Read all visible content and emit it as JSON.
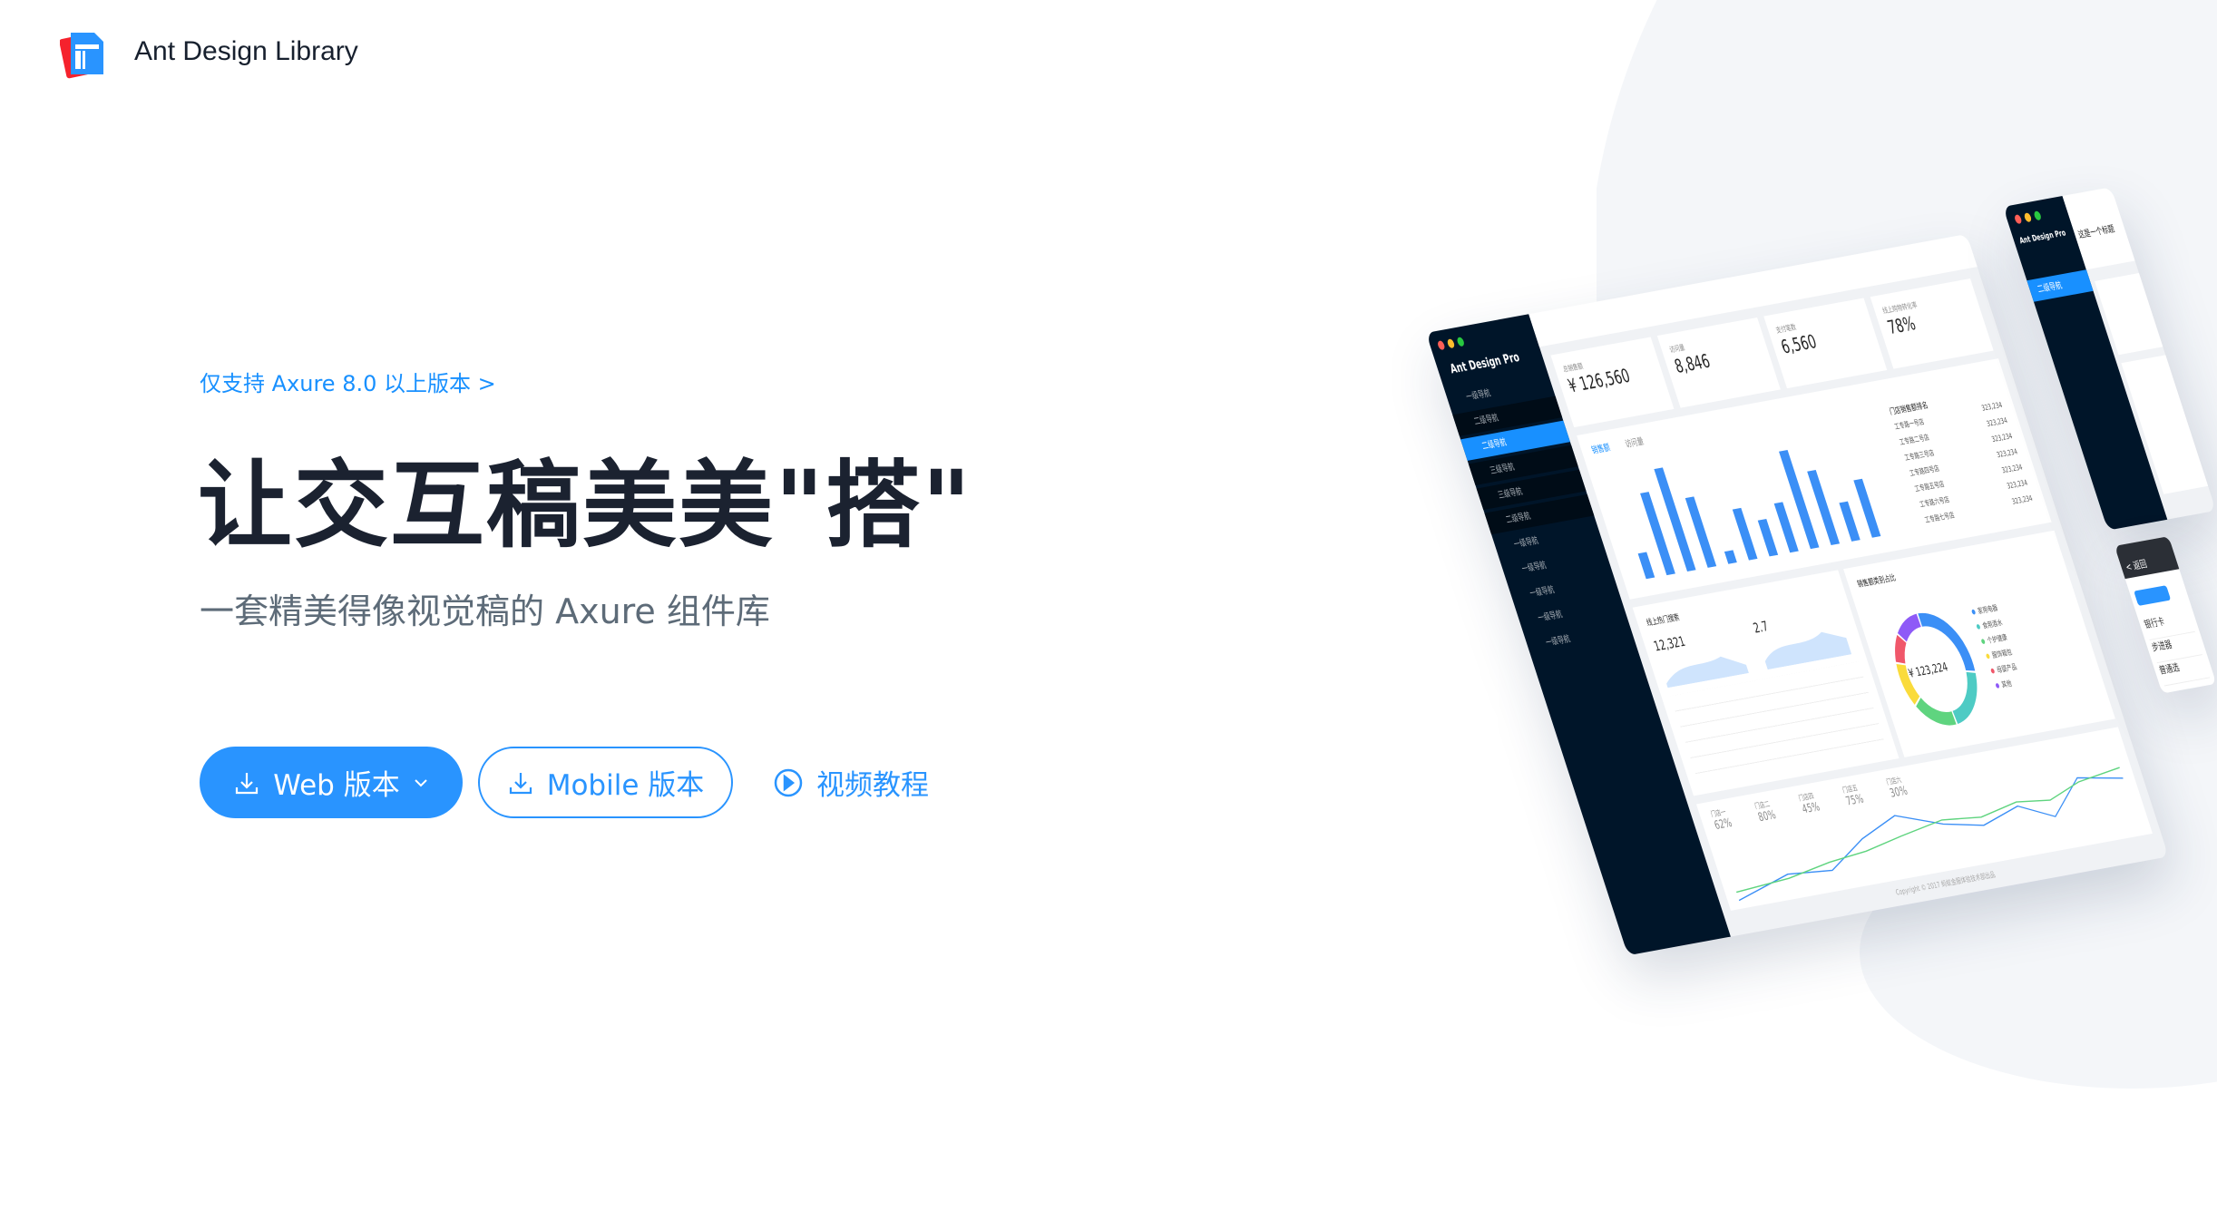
{
  "brand": {
    "name": "Ant Design Library",
    "colors": {
      "red": "#f5222d",
      "blue": "#2994ff"
    }
  },
  "hero": {
    "support_link": "仅支持 Axure 8.0 以上版本 >",
    "title": "让交互稿美美\"搭\"",
    "subtitle": "一套精美得像视觉稿的 Axure 组件库"
  },
  "actions": {
    "web": {
      "label": "Web 版本",
      "icon": "download-icon",
      "dropdown_icon": "chevron-down-icon"
    },
    "mobile": {
      "label": "Mobile 版本",
      "icon": "download-icon"
    },
    "video": {
      "label": "视频教程",
      "icon": "play-circle-icon"
    }
  },
  "colors": {
    "primary": "#1890ff",
    "button": "#2994ff",
    "title": "#1b2230",
    "subtitle": "#5d6b78",
    "sidebar": "#001529"
  },
  "mockup": {
    "app_title": "Ant Design Pro",
    "nav": [
      "一级导航",
      "二级导航",
      "二级导航",
      "三级导航",
      "三级导航",
      "二级导航",
      "一级导航",
      "一级导航",
      "一级导航",
      "一级导航",
      "一级导航"
    ],
    "stats": [
      {
        "label": "总销售额",
        "value": "¥ 126,560"
      },
      {
        "label": "访问量",
        "value": "8,846"
      },
      {
        "label": "支付笔数",
        "value": "6,560"
      },
      {
        "label": "线上购物转化率",
        "value": "78%"
      }
    ],
    "tabs": [
      "销售额",
      "访问量"
    ],
    "bars": [
      250,
      800,
      1000,
      680,
      120,
      500,
      350,
      480,
      950,
      720,
      380,
      560
    ],
    "ranking_title": "门店销售额排名",
    "ranking": [
      "工专路一号店",
      "工专路二号店",
      "工专路三号店",
      "工专路四号店",
      "工专路五号店",
      "工专路六号店",
      "工专路七号店"
    ],
    "ranking_value": "323,234",
    "search_title": "线上热门搜索",
    "search_users": "12,321",
    "search_avg": "2.7",
    "donut_title": "销售额类别占比",
    "donut_total": "¥ 123,224",
    "donut_series": [
      {
        "name": "家用电器",
        "value": 28,
        "color": "#3b8ff6"
      },
      {
        "name": "食用酒水",
        "value": 21,
        "color": "#4ecbc4"
      },
      {
        "name": "个护健康",
        "value": 17,
        "color": "#5fd47f"
      },
      {
        "name": "服饰箱包",
        "value": 13,
        "color": "#fadb3b"
      },
      {
        "name": "母婴产品",
        "value": 9,
        "color": "#f0576a"
      },
      {
        "name": "其他",
        "value": 12,
        "color": "#8e5af7"
      }
    ],
    "stores": [
      {
        "name": "门店一",
        "rate": "62%"
      },
      {
        "name": "门店二",
        "rate": "80%"
      },
      {
        "name": "门店四",
        "rate": "45%"
      },
      {
        "name": "门店五",
        "rate": "75%"
      },
      {
        "name": "门店六",
        "rate": "30%"
      }
    ],
    "footer": "Copyright © 2017 蚂蚁金服体验技术部出品",
    "side_title": "这是一个标题",
    "phone_back": "< 返回",
    "phone_items": [
      "银行卡",
      "步进器",
      "普通选"
    ]
  }
}
